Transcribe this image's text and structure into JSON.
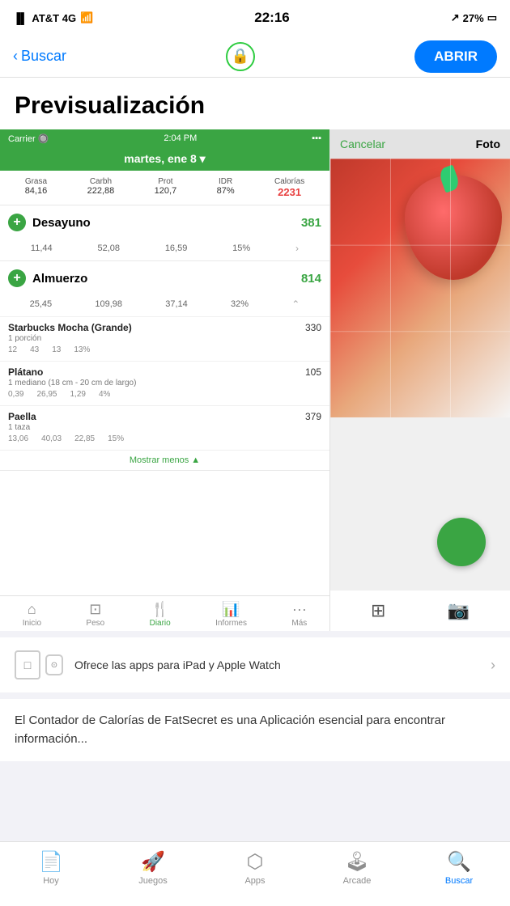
{
  "status_bar": {
    "carrier": "AT&T 4G",
    "wifi": "📶",
    "time": "22:16",
    "location": "↗",
    "battery": "27%"
  },
  "nav": {
    "back_label": "Buscar",
    "lock_icon": "🔒",
    "open_button": "ABRIR"
  },
  "page": {
    "title": "Previsualización"
  },
  "app_ui": {
    "status": {
      "carrier": "Carrier",
      "wifi": "WiFi",
      "time": "2:04 PM",
      "battery": "▪▪▪"
    },
    "date": "martes, ene 8 ▾",
    "macros": {
      "labels": [
        "Grasa",
        "Carbh",
        "Prot",
        "IDR",
        "Calorías"
      ],
      "values": [
        "84,16",
        "222,88",
        "120,7",
        "87%",
        "2231"
      ]
    },
    "meals": [
      {
        "name": "Desayuno",
        "calories": "381",
        "macros": [
          "11,44",
          "52,08",
          "16,59",
          "15%"
        ],
        "expanded": false,
        "foods": []
      },
      {
        "name": "Almuerzo",
        "calories": "814",
        "macros": [
          "25,45",
          "109,98",
          "37,14",
          "32%"
        ],
        "expanded": true,
        "foods": [
          {
            "name": "Starbucks Mocha (Grande)",
            "calories": "330",
            "portion": "1 porción",
            "macros": [
              "12",
              "43",
              "13",
              "13%"
            ]
          },
          {
            "name": "Plátano",
            "calories": "105",
            "portion": "1 mediano (18 cm - 20 cm de largo)",
            "macros": [
              "0,39",
              "26,95",
              "1,29",
              "4%"
            ]
          },
          {
            "name": "Paella",
            "calories": "379",
            "portion": "1 taza",
            "macros": [
              "13,06",
              "40,03",
              "22,85",
              "15%"
            ]
          }
        ]
      }
    ],
    "show_less": "Mostrar menos ▲",
    "tabs": [
      {
        "icon": "🏠",
        "label": "Inicio",
        "active": false
      },
      {
        "icon": "⚖",
        "label": "Peso",
        "active": false
      },
      {
        "icon": "🍴",
        "label": "Diario",
        "active": true
      },
      {
        "icon": "📊",
        "label": "Informes",
        "active": false
      },
      {
        "icon": "•••",
        "label": "Más",
        "active": false
      }
    ]
  },
  "photo_ui": {
    "cancel_label": "Cancelar",
    "photo_label": "Foto"
  },
  "compat": {
    "text": "Ofrece las apps para iPad y Apple Watch",
    "chevron": "›"
  },
  "description": {
    "text": "El Contador de Calorías de FatSecret es una Aplicación esencial para encontrar información..."
  },
  "bottom_tabs": [
    {
      "icon": "📄",
      "label": "Hoy",
      "active": false
    },
    {
      "icon": "🚀",
      "label": "Juegos",
      "active": false
    },
    {
      "icon": "⬡",
      "label": "Apps",
      "active": false
    },
    {
      "icon": "🎮",
      "label": "Arcade",
      "active": false
    },
    {
      "icon": "🔍",
      "label": "Buscar",
      "active": true
    }
  ]
}
